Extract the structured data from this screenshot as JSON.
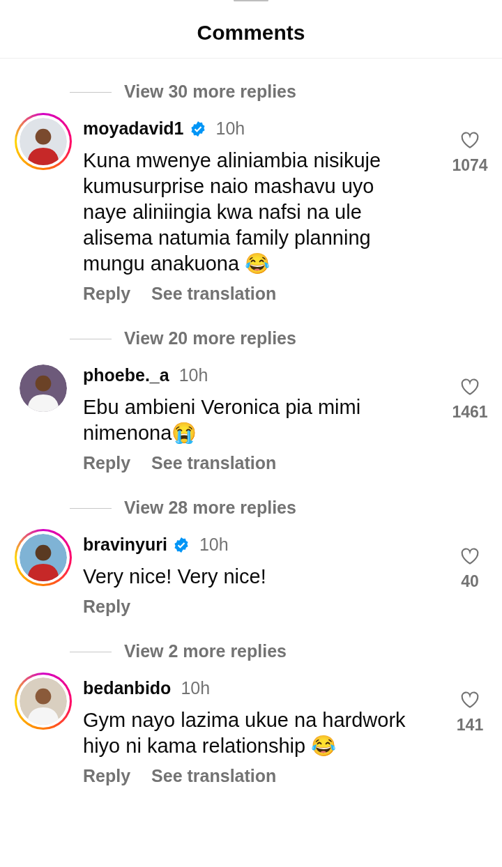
{
  "header": {
    "title": "Comments"
  },
  "items": [
    {
      "kind": "more",
      "label": "View 30 more replies"
    },
    {
      "kind": "comment",
      "username": "moyadavid1",
      "verified": true,
      "story_ring": true,
      "time": "10h",
      "text": "Kuna mwenye aliniambia nisikuje kumusurprise naio mashavu uyo naye aliniingia kwa nafsi na ule alisema natumia family planning mungu anakuona 😂",
      "likes": "1074",
      "actions": [
        "Reply",
        "See translation"
      ]
    },
    {
      "kind": "more",
      "label": "View 20 more replies"
    },
    {
      "kind": "comment",
      "username": "phoebe._a",
      "verified": false,
      "story_ring": false,
      "time": "10h",
      "text": "Ebu ambieni Veronica pia mimi nimenona😭",
      "likes": "1461",
      "actions": [
        "Reply",
        "See translation"
      ]
    },
    {
      "kind": "more",
      "label": "View 28 more replies"
    },
    {
      "kind": "comment",
      "username": "bravinyuri",
      "verified": true,
      "story_ring": true,
      "time": "10h",
      "text": "Very nice! Very nice!",
      "likes": "40",
      "actions": [
        "Reply"
      ]
    },
    {
      "kind": "more",
      "label": "View 2 more replies"
    },
    {
      "kind": "comment",
      "username": "bedanbido",
      "verified": false,
      "story_ring": true,
      "time": "10h",
      "text": "Gym nayo lazima ukue na hardwork hiyo ni kama relationship 😂",
      "likes": "141",
      "actions": [
        "Reply",
        "See translation"
      ]
    }
  ]
}
